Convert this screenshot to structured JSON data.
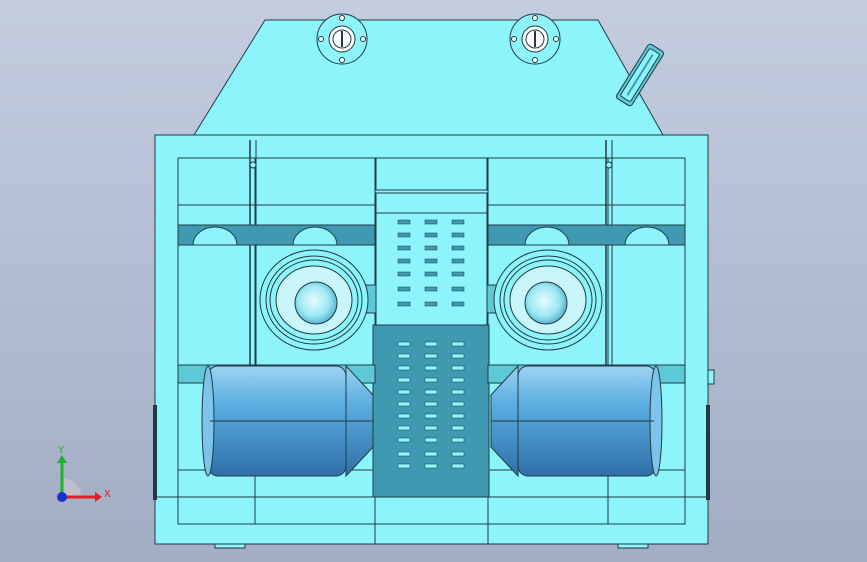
{
  "viewport": {
    "background_top": "#c4cde0",
    "background_bottom": "#a2adc4"
  },
  "model": {
    "body_color": "#8cf4fa",
    "shade_color": "#5ec9d6",
    "panel_color": "#3f9ab1",
    "motor_color": "#5aaee0",
    "motor_shade": "#2f6fa8",
    "edge_color": "#1f3b45"
  },
  "triad": {
    "x_label": "X",
    "y_label": "Y",
    "x_color": "#e02020",
    "y_color": "#20b030",
    "z_color": "#2030d0"
  }
}
